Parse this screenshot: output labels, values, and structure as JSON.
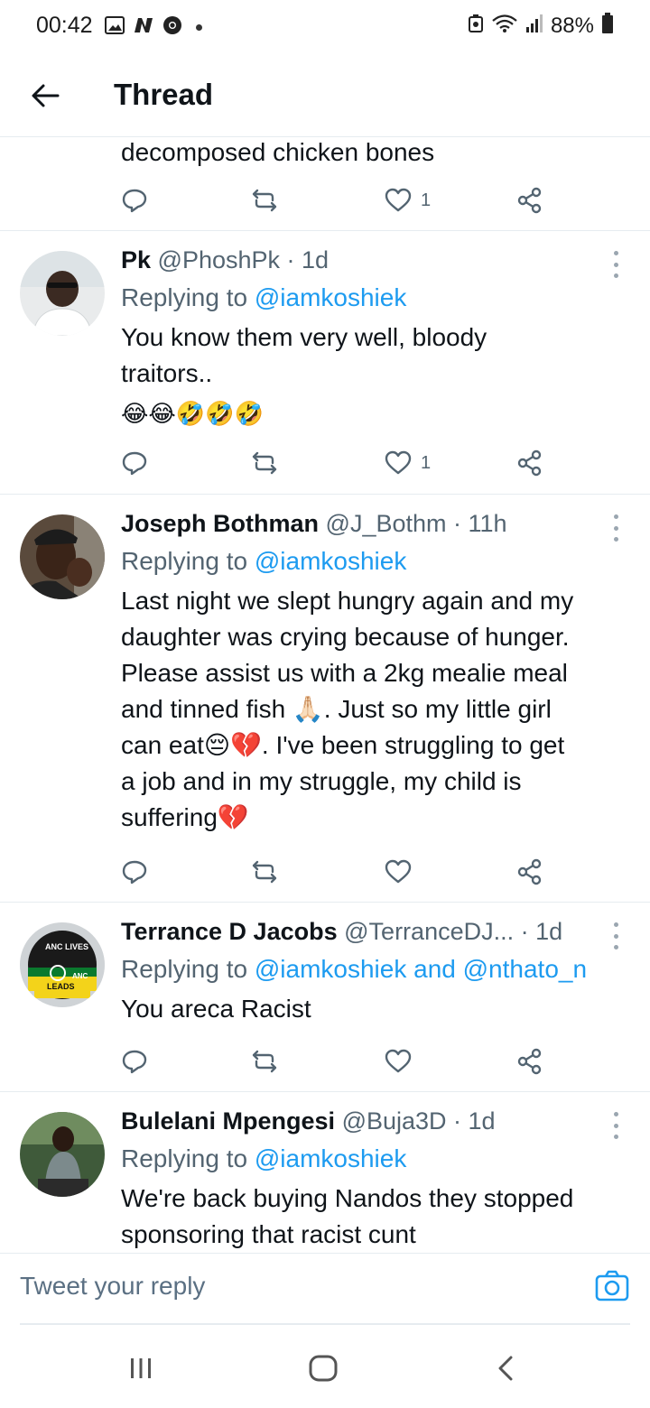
{
  "status_bar": {
    "time": "00:42",
    "battery": "88%",
    "left_icons": [
      "gallery-icon",
      "n-app-icon",
      "chrome-icon",
      "dot-icon"
    ],
    "right_icons": [
      "recycle-icon",
      "wifi-icon",
      "signal-icon",
      "battery-icon"
    ]
  },
  "header": {
    "title": "Thread"
  },
  "partial_tweet": {
    "text": "decomposed chicken bones",
    "like_count": "1"
  },
  "tweets": [
    {
      "name": "Pk",
      "handle": "@PhoshPk",
      "time": "1d",
      "replying_prefix": "Replying to ",
      "replying_to": "@iamkoshiek",
      "text": "You know them very well, bloody traitors..",
      "emoji_line": "😂😂🤣🤣🤣",
      "like_count": "1"
    },
    {
      "name": "Joseph Bothman",
      "handle": "@J_Bothm",
      "time": "11h",
      "replying_prefix": "Replying to ",
      "replying_to": "@iamkoshiek",
      "text_lines": [
        "Last night we slept hungry again and my",
        "daughter was crying because of hunger.",
        "Please assist us with a 2kg mealie meal",
        "and tinned fish 🙏🏻. Just so my little girl",
        "can eat😔💔. I've been struggling to get",
        "a job and in my struggle, my child is",
        "suffering💔"
      ],
      "like_count": ""
    },
    {
      "name": "Terrance D Jacobs",
      "handle": "@TerranceDJ...",
      "time": "1d",
      "replying_prefix": "Replying to ",
      "replying_to": "@iamkoshiek and @nthato_n",
      "text": "You areca Racist",
      "avatar_text": {
        "top": "ANC LIVES",
        "middle": "ANC",
        "bottom": "LEADS"
      },
      "like_count": ""
    },
    {
      "name": "Bulelani Mpengesi",
      "handle": "@Buja3D",
      "time": "1d",
      "replying_prefix": "Replying to ",
      "replying_to": "@iamkoshiek",
      "text_lines": [
        "We're back buying Nandos they stopped",
        "sponsoring that racist cunt"
      ]
    }
  ],
  "separator": " · ",
  "reply_bar": {
    "placeholder": "Tweet your reply"
  },
  "colors": {
    "link": "#1d9bf0",
    "secondary_text": "#536471",
    "primary_text": "#0f1419",
    "divider": "#e6ecf0"
  }
}
